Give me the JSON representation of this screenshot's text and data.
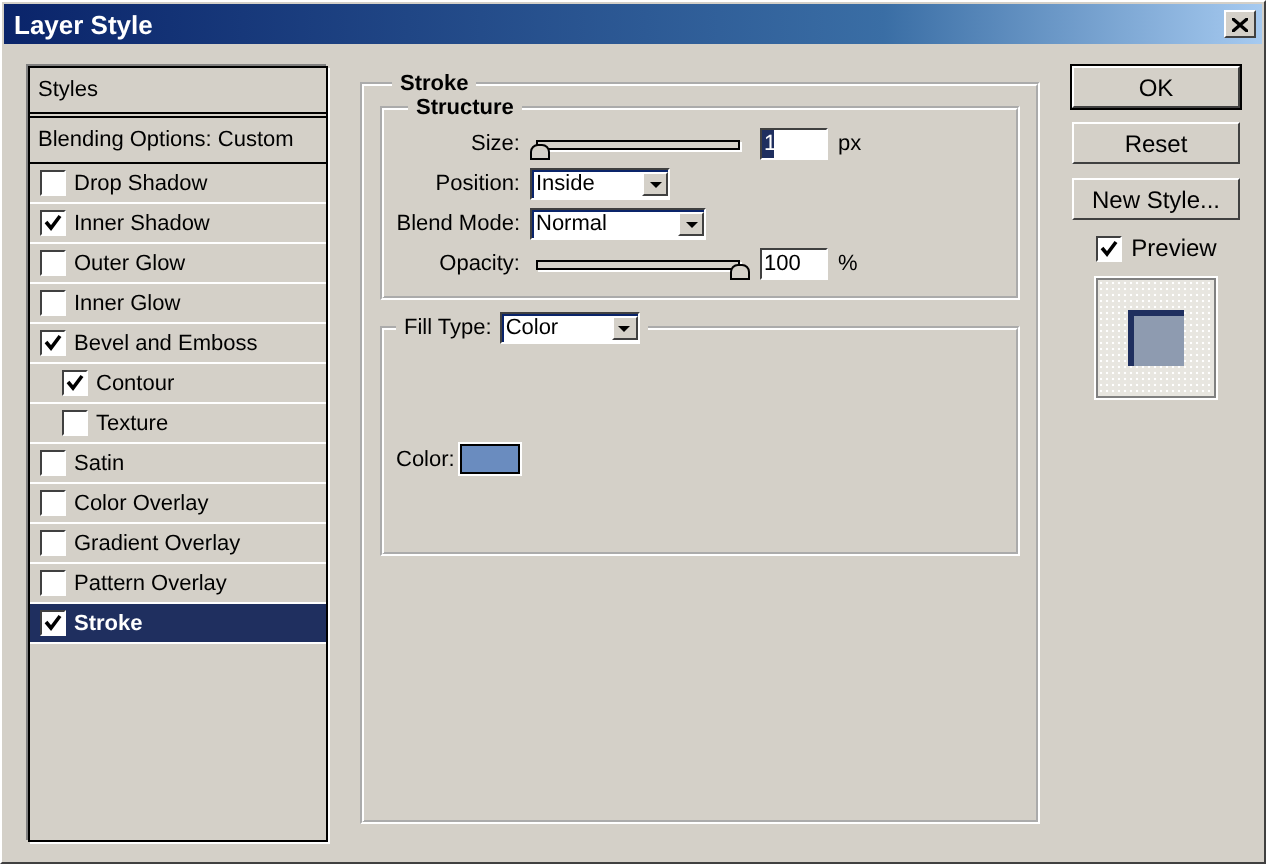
{
  "window": {
    "title": "Layer Style"
  },
  "styles_panel": {
    "header": "Styles",
    "blending": {
      "label": "Blending Options: Custom",
      "selected": false
    },
    "items": [
      {
        "label": "Drop Shadow",
        "checked": false,
        "selected": false
      },
      {
        "label": "Inner Shadow",
        "checked": true,
        "selected": false
      },
      {
        "label": "Outer Glow",
        "checked": false,
        "selected": false
      },
      {
        "label": "Inner Glow",
        "checked": false,
        "selected": false
      },
      {
        "label": "Bevel and Emboss",
        "checked": true,
        "selected": false,
        "children": [
          {
            "label": "Contour",
            "checked": true,
            "selected": false
          },
          {
            "label": "Texture",
            "checked": false,
            "selected": false
          }
        ]
      },
      {
        "label": "Satin",
        "checked": false,
        "selected": false
      },
      {
        "label": "Color Overlay",
        "checked": false,
        "selected": false
      },
      {
        "label": "Gradient Overlay",
        "checked": false,
        "selected": false
      },
      {
        "label": "Pattern Overlay",
        "checked": false,
        "selected": false
      },
      {
        "label": "Stroke",
        "checked": true,
        "selected": true
      }
    ]
  },
  "stroke": {
    "title": "Stroke",
    "structure": {
      "title": "Structure",
      "size": {
        "label": "Size:",
        "level": 0,
        "value": "1",
        "unit": "px"
      },
      "position": {
        "label": "Position:",
        "value": "Inside"
      },
      "blend_mode": {
        "label": "Blend Mode:",
        "value": "Normal"
      },
      "opacity": {
        "label": "Opacity:",
        "level": 1,
        "value": "100",
        "unit": "%"
      }
    },
    "fill": {
      "label": "Fill Type:",
      "value": "Color",
      "color_label": "Color:",
      "color": "#6a8cbf"
    }
  },
  "buttons": [
    {
      "label": "OK",
      "default": true
    },
    {
      "label": "Reset",
      "default": false
    },
    {
      "label": "New Style...",
      "default": false
    }
  ],
  "preview": {
    "label": "Preview",
    "checked": true
  }
}
